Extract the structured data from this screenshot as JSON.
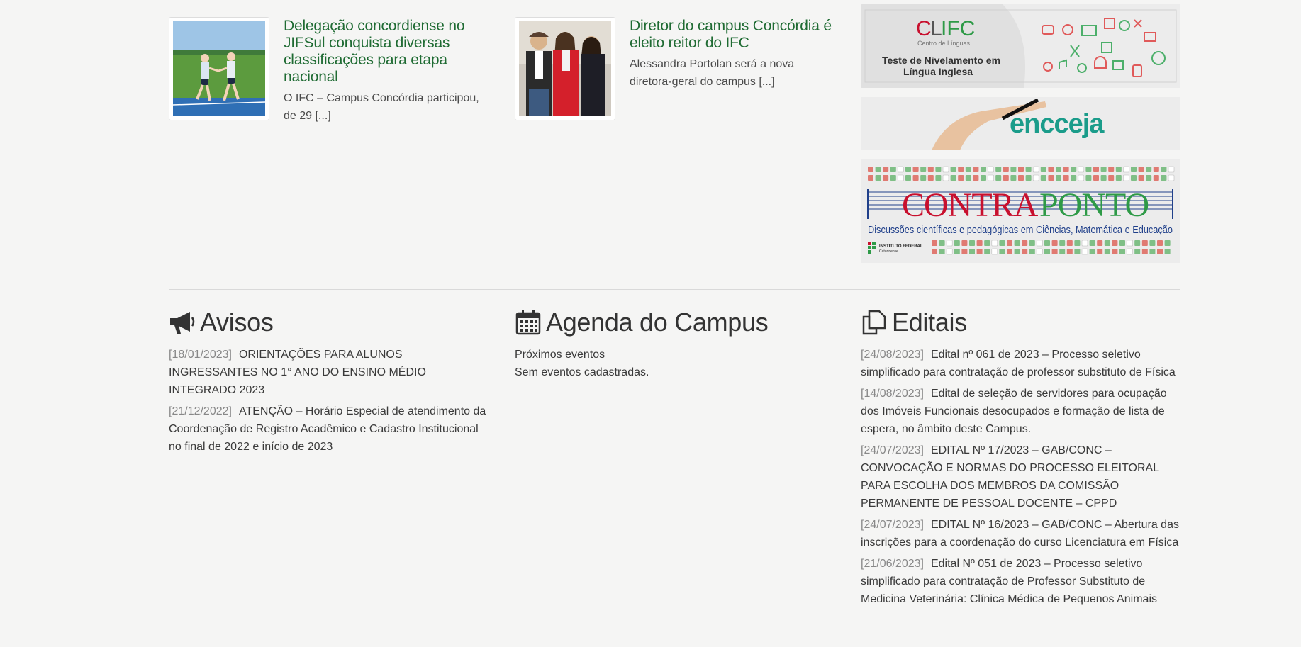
{
  "news": [
    {
      "title": "Delegação concordiense no JIFSul conquista diversas classificações para etapa nacional",
      "excerpt": "O IFC – Campus Concórdia participou, de 29 [...]"
    },
    {
      "title": "Diretor do campus Concórdia é eleito reitor do IFC",
      "excerpt": "Alessandra Portolan será a nova diretora-geral do campus [...]"
    }
  ],
  "banners": {
    "clifc": {
      "logo_c": "C",
      "logo_l": "L",
      "logo_ifc": "IFC",
      "logo_sub": "Centro de Línguas",
      "line1": "Teste de Nivelamento em",
      "line2": "Língua Inglesa"
    },
    "encceja": {
      "logo": "encceja"
    },
    "contraponto": {
      "title_red": "CONTRA",
      "title_green": "PONTO",
      "subtitle": "Discussões científicas e pedagógicas em Ciências, Matemática e Educação",
      "inst_line1": "INSTITUTO FEDERAL",
      "inst_line2": "Catarinense"
    }
  },
  "avisos": {
    "heading": "Avisos",
    "items": [
      {
        "date": "[18/01/2023]",
        "text": "ORIENTAÇÕES PARA ALUNOS INGRESSANTES NO 1° ANO DO ENSINO MÉDIO INTEGRADO 2023"
      },
      {
        "date": "[21/12/2022]",
        "text": "ATENÇÃO – Horário Especial de atendimento da Coordenação de Registro Acadêmico e Cadastro Institucional no final de 2022 e início de 2023"
      }
    ]
  },
  "agenda": {
    "heading": "Agenda do Campus",
    "subheading": "Próximos eventos",
    "empty": "Sem eventos cadastradas."
  },
  "editais": {
    "heading": "Editais",
    "items": [
      {
        "date": "[24/08/2023]",
        "text": "Edital nº 061 de 2023 – Processo seletivo simplificado para contratação de professor substituto de Física"
      },
      {
        "date": "[14/08/2023]",
        "text": "Edital de seleção de servidores para ocupação dos Imóveis Funcionais desocupados e formação de lista de espera, no âmbito deste Campus."
      },
      {
        "date": "[24/07/2023]",
        "text": "EDITAL Nº 17/2023 – GAB/CONC – CONVOCAÇÃO E NORMAS DO PROCESSO ELEITORAL PARA ESCOLHA DOS MEMBROS DA COMISSÃO PERMANENTE DE PESSOAL DOCENTE – CPPD"
      },
      {
        "date": "[24/07/2023]",
        "text": "EDITAL Nº 16/2023 – GAB/CONC – Abertura das inscrições para a coordenação do curso Licenciatura em Física"
      },
      {
        "date": "[21/06/2023]",
        "text": "Edital Nº 051 de 2023 – Processo seletivo simplificado para contratação de Professor Substituto de Medicina Veterinária: Clínica Médica de Pequenos Animais"
      }
    ]
  },
  "colors": {
    "link_green": "#1f6b33",
    "ifc_red": "#c8102e",
    "ifc_green": "#2e9a47"
  }
}
